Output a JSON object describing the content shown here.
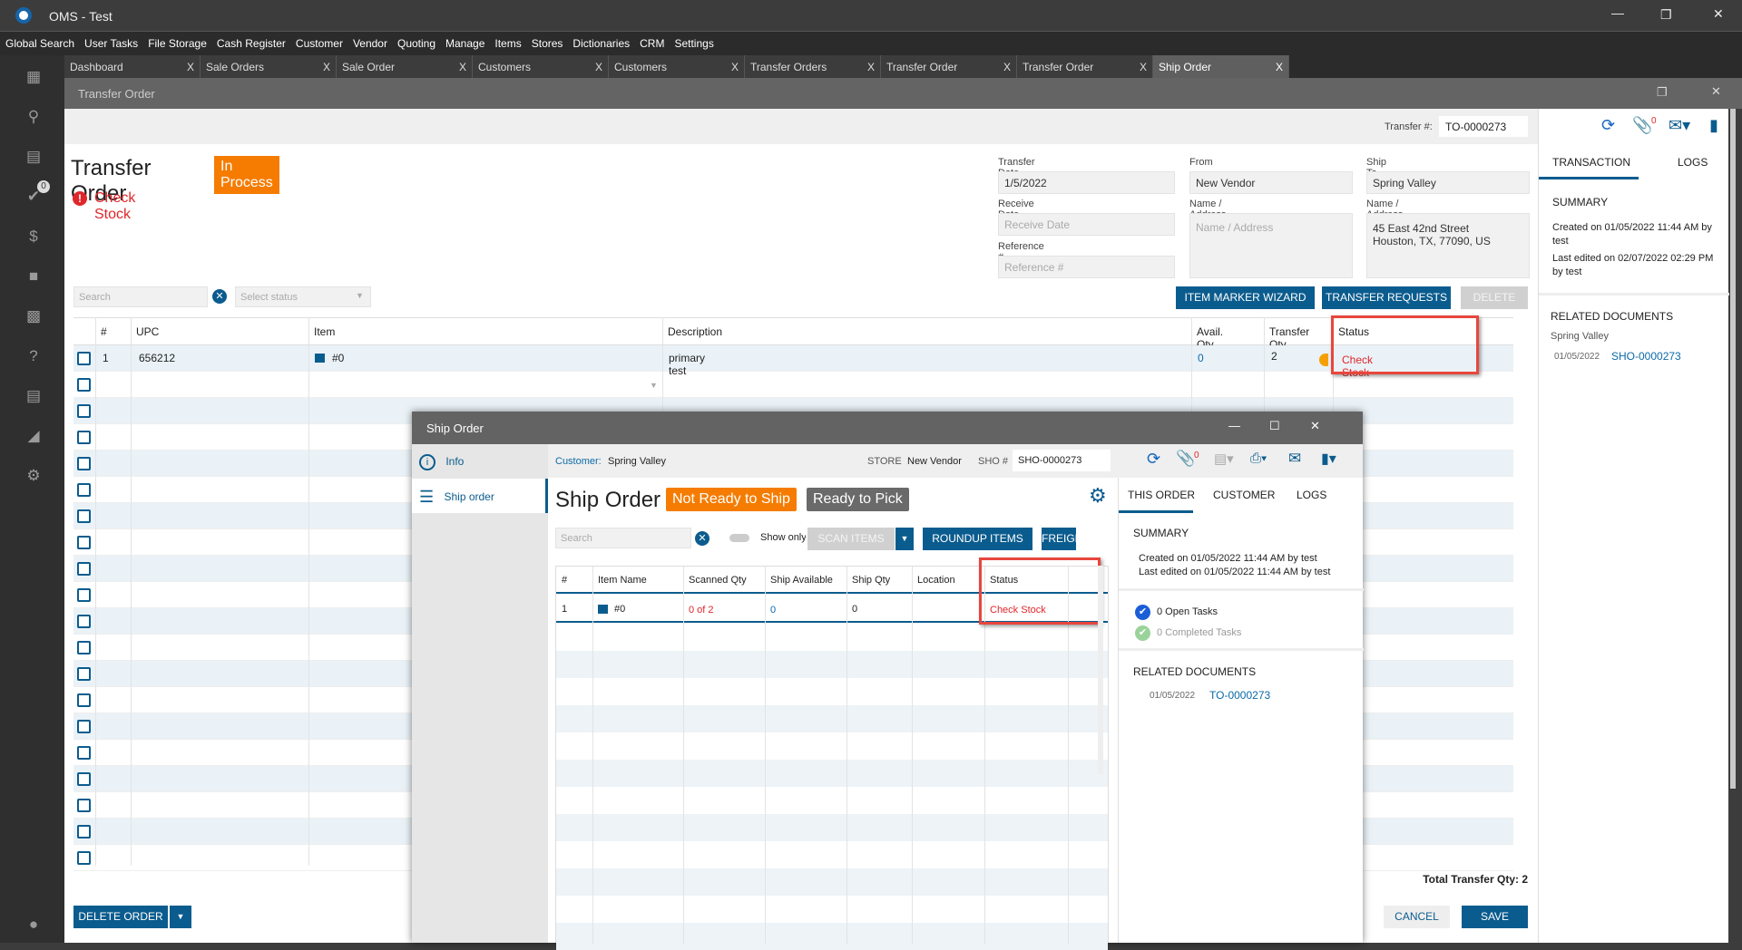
{
  "app": {
    "title": "OMS - Test"
  },
  "menu": [
    "Global Search",
    "User Tasks",
    "File Storage",
    "Cash Register",
    "Customer",
    "Vendor",
    "Quoting",
    "Manage",
    "Items",
    "Stores",
    "Dictionaries",
    "CRM",
    "Settings"
  ],
  "tabs": [
    "Dashboard",
    "Sale Orders",
    "Sale Order",
    "Customers",
    "Customers",
    "Transfer Orders",
    "Transfer Order",
    "Transfer Order",
    "Ship Order"
  ],
  "tab_close": "X",
  "sidebar_badge": "0",
  "window": {
    "title": "Transfer Order"
  },
  "transfer": {
    "number_label": "Transfer #:",
    "number": "TO-0000273",
    "attach_count": "0",
    "title": "Transfer Order",
    "status": "In Process",
    "warning": "Check Stock",
    "transfer_date_label": "Transfer Date",
    "transfer_date": "1/5/2022",
    "receive_date_label": "Receive Date",
    "receive_date_ph": "Receive Date",
    "reference_label": "Reference #",
    "reference_ph": "Reference #",
    "from_label": "From",
    "from": "New Vendor",
    "from_addr_label": "Name / Address",
    "from_addr_ph": "Name / Address",
    "shipto_label": "Ship To",
    "shipto": "Spring Valley",
    "shipto_addr_label": "Name / Address",
    "shipto_addr1": "45 East 42nd Street",
    "shipto_addr2": "Houston, TX, 77090, US",
    "search_ph": "Search",
    "status_ph": "Select status",
    "btn_wizard": "ITEM MARKER WIZARD",
    "btn_requests": "TRANSFER REQUESTS",
    "btn_delete": "DELETE",
    "columns": [
      "#",
      "UPC",
      "Item",
      "Description",
      "Avail. Qty",
      "Transfer Qty",
      "Status"
    ],
    "rows": [
      {
        "n": "1",
        "upc": "656212",
        "item": "#0",
        "desc": "primary test",
        "avail": "0",
        "qty": "2",
        "status": "Check Stock"
      }
    ],
    "total": "Total Transfer Qty: 2",
    "btn_delete_order": "DELETE ORDER",
    "btn_cancel": "CANCEL",
    "btn_save": "SAVE"
  },
  "right": {
    "tabs": [
      "TRANSACTION",
      "LOGS"
    ],
    "summary": "SUMMARY",
    "created": "Created on 01/05/2022 11:44 AM by test",
    "edited": "Last edited on 02/07/2022 02:29 PM by test",
    "related": "RELATED DOCUMENTS",
    "related_group": "Spring Valley",
    "related_date": "01/05/2022",
    "related_doc": "SHO-0000273"
  },
  "ship": {
    "title": "Ship Order",
    "nav": [
      "Info",
      "Ship order"
    ],
    "customer_label": "Customer:",
    "customer": "Spring Valley",
    "store_label": "STORE",
    "store": "New Vendor",
    "sho_label": "SHO #",
    "sho": "SHO-0000273",
    "attach_count": "0",
    "heading": "Ship Order",
    "badge1": "Not Ready to Ship",
    "badge2": "Ready to Pick",
    "search_ph": "Search",
    "show_only": "Show only",
    "btn_scan": "SCAN ITEMS",
    "btn_roundup": "ROUNDUP ITEMS",
    "btn_freight": "FREIGHT",
    "columns": [
      "#",
      "Item Name",
      "Scanned Qty",
      "Ship Available",
      "Ship Qty",
      "Location",
      "Status"
    ],
    "row": {
      "n": "1",
      "item": "#0",
      "scanned": "0 of 2",
      "avail": "0",
      "qty": "0",
      "location": "",
      "status": "Check Stock"
    },
    "rtabs": [
      "THIS ORDER",
      "CUSTOMER",
      "LOGS"
    ],
    "summary": "SUMMARY",
    "created": "Created on 01/05/2022 11:44 AM by test",
    "edited": "Last edited on 01/05/2022 11:44 AM by test",
    "open_tasks": "0 Open Tasks",
    "completed_tasks": "0 Completed Tasks",
    "related": "RELATED DOCUMENTS",
    "related_date": "01/05/2022",
    "related_doc": "TO-0000273"
  },
  "colors": {
    "accent": "#0b5c8e",
    "orange": "#f57c00",
    "red": "#e0262a",
    "highlight": "#e8463d"
  }
}
